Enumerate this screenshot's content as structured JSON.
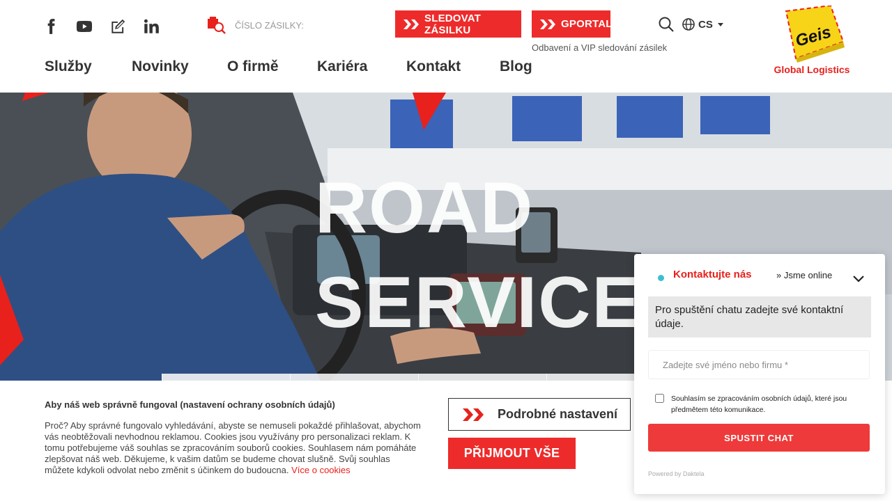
{
  "header": {
    "social": [
      "facebook-icon",
      "youtube-icon",
      "edit-icon",
      "linkedin-icon"
    ],
    "tracking_placeholder": "ČÍSLO ZÁSILKY:",
    "track_button": "SLEDOVAT ZÁSILKU",
    "gportal_button": "GPORTAL",
    "gportal_subtitle": "Odbavení a VIP sledování zásilek",
    "language": "CS",
    "logo_text": "Global Logistics",
    "logo_mark": "Geis"
  },
  "nav": {
    "items": [
      "Služby",
      "Novinky",
      "O firmě",
      "Kariéra",
      "Kontakt",
      "Blog"
    ]
  },
  "hero": {
    "line1": "ROAD",
    "line2": "SERVICES"
  },
  "cookie": {
    "title": "Aby náš web správně fungoval (nastavení ochrany osobních údajů)",
    "text": "Proč? Aby správné fungovalo vyhledávání, abyste se nemuseli pokaždé přihlašovat, abychom vás neobtěžovali nevhodnou reklamou. Cookies jsou využívány pro personalizaci reklam. K tomu potřebujeme váš souhlas se zpracováním souborů cookies. Souhlasem nám pomáháte zlepšovat náš web. Děkujeme, k vašim datům se budeme chovat slušně. Svůj souhlas můžete kdykoli odvolat nebo změnit s účinkem do budoucna.",
    "more_link": "Více o cookies",
    "detail_button": "Podrobné nastavení",
    "accept_button": "PŘIJMOUT VŠE"
  },
  "chat": {
    "title": "Kontaktujte nás",
    "status": "» Jsme online",
    "info": "Pro spuštění chatu zadejte své kontaktní údaje.",
    "name_placeholder": "Zadejte své jméno nebo firmu *",
    "consent": "Souhlasím se zpracováním osobních údajů, které jsou předmětem této komunikace.",
    "start_button": "SPUSTIT CHAT",
    "powered": "Powered by Daktela"
  },
  "colors": {
    "brand_red": "#ee2b2b",
    "brand_yellow": "#f7d417",
    "online_dot": "#3dbfd1"
  }
}
